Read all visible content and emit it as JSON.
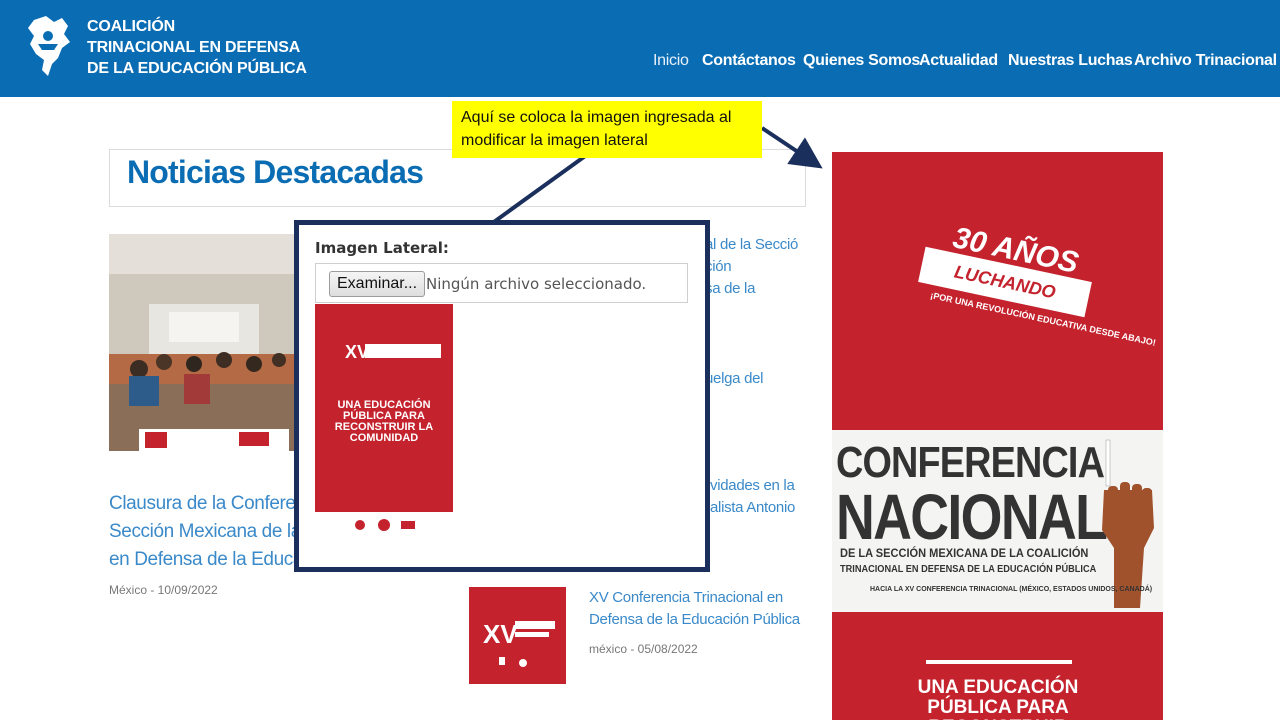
{
  "header": {
    "logo_lines": [
      "COALICIÓN",
      "TRINACIONAL EN DEFENSA",
      "DE LA EDUCACIÓN PÚBLICA"
    ],
    "nav": [
      "Inicio",
      "Contáctanos",
      "Quienes Somos",
      "Actualidad",
      "Nuestras Luchas",
      "Archivo Trinacional"
    ],
    "bg_color": "#0a6db3"
  },
  "section": {
    "title": "Noticias Destacadas"
  },
  "featured": {
    "title_lines": [
      "Clausura de la Conferenc",
      "Sección Mexicana de la C",
      "en Defensa de la Educac"
    ],
    "meta": "México - 10/09/2022"
  },
  "partials": {
    "p1": [
      "al de la Secció",
      "ción",
      "sa de la"
    ],
    "p2": [
      "uelga del"
    ],
    "p3": [
      "vidades en la",
      "alista Antonio"
    ]
  },
  "small_news": {
    "title_lines": [
      "XV Conferencia Trinacional en",
      "Defensa de la Educación Pública"
    ],
    "meta": "méxico - 05/08/2022"
  },
  "poster": {
    "thirty": "30 AÑOS",
    "luchando": "LUCHANDO",
    "slogan": "¡POR UNA REVOLUCIÓN EDUCATIVA DESDE ABAJO!",
    "conf_line1": "CONFERENCIA",
    "conf_line2": "NACIONAL",
    "sub1": "DE LA SECCIÓN MEXICANA DE LA COALICIÓN",
    "sub2": "TRINACIONAL EN DEFENSA DE LA EDUCACIÓN PÚBLICA",
    "sub3": "HACIA LA XV CONFERENCIA TRINACIONAL (MÉXICO, ESTADOS UNIDOS, CANADÁ)",
    "bottom": "UNA EDUCACIÓN PÚBLICA PARA RECONSTRUIR"
  },
  "callout": {
    "lines": [
      "Aquí  se coloca la imagen ingresada al",
      "modificar la imagen lateral"
    ]
  },
  "modal": {
    "label": "Imagen Lateral:",
    "browse_button": "Examinar...",
    "file_status": "Ningún archivo seleccionado.",
    "thumb_xv": "XV",
    "thumb_text": "UNA EDUCACIÓN PÚBLICA PARA RECONSTRUIR LA COMUNIDAD"
  },
  "colors": {
    "accent": "#0a6db3",
    "poster_red": "#c4232e",
    "callout_yellow": "#ffff00",
    "modal_border": "#1a2f5c",
    "link": "#3a89c9"
  }
}
